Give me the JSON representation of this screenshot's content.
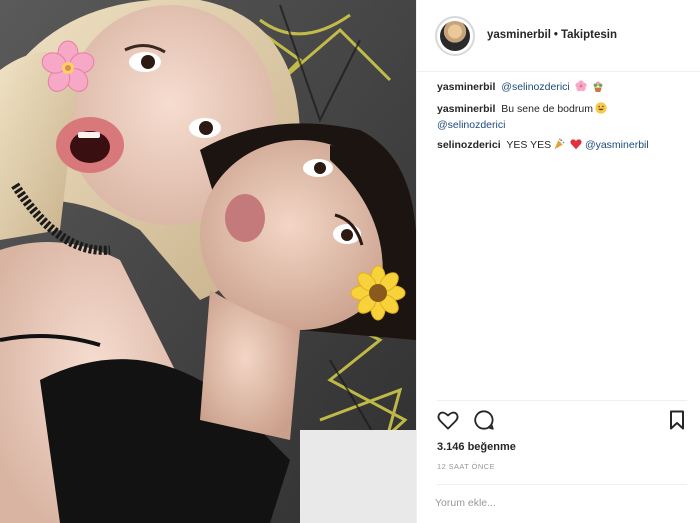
{
  "post": {
    "username": "yasminerbil",
    "separator": "•",
    "follow_status": "Takiptesin",
    "likes": "3.146 beğenme",
    "time_ago": "12 SAAT ÖNCE",
    "comment_placeholder": "Yorum ekle..."
  },
  "comments": [
    {
      "user": "yasminerbil",
      "text": "",
      "mention": "@selinozderici",
      "emojis": [
        "cherry-blossom-emoji",
        "potted-flower-emoji"
      ]
    },
    {
      "user": "yasminerbil",
      "text": "Bu sene de bodrum",
      "mention": "@selinozderici",
      "emojis": [
        "grinning-face-emoji"
      ]
    },
    {
      "user": "selinozderici",
      "text": "YES YES",
      "mention": "@yasminerbil",
      "emojis": [
        "party-emoji",
        "red-heart-emoji"
      ]
    }
  ],
  "photo": {
    "stickers": [
      "cherry-blossom-sticker",
      "sunflower-sticker"
    ]
  },
  "icons": {
    "like": "heart-icon",
    "comment": "speech-bubble-icon",
    "save": "bookmark-icon"
  },
  "colors": {
    "text": "#262626",
    "muted": "#999999",
    "mention": "#1d4a7a",
    "border": "#efefef"
  }
}
